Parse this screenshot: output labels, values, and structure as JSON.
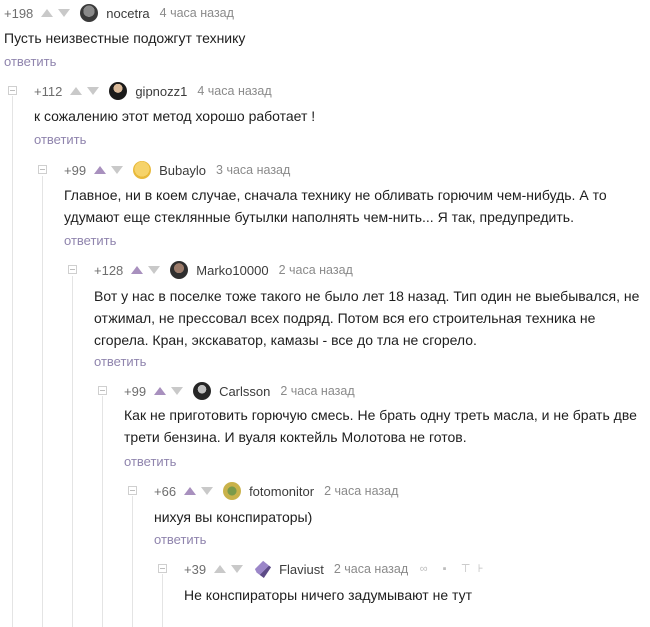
{
  "comments": [
    {
      "rating": "+198",
      "author": "nocetra",
      "time": "4 часа назад",
      "text": [
        "Пусть неизвестные подожгут технику"
      ],
      "reply": "ответить"
    },
    {
      "rating": "+112",
      "author": "gipnozz1",
      "time": "4 часа назад",
      "text": [
        "к сожалению этот метод хорошо работает !"
      ],
      "reply": "ответить"
    },
    {
      "rating": "+99",
      "author": "Bubaylo",
      "time": "3 часа назад",
      "text": [
        "Главное, ни в коем случае, сначала технику не обливать горючим чем-нибудь. А то",
        "удумают еще стеклянные бутылки наполнять чем-нить... Я так, предупредить."
      ],
      "reply": "ответить"
    },
    {
      "rating": "+128",
      "author": "Marko10000",
      "time": "2 часа назад",
      "text": [
        "Вот у нас в поселке тоже такого не было лет 18 назад. Тип один не выебывался, не",
        "отжимал, не прессовал всех подряд. Потом вся его строительная техника не",
        "сгорела. Кран, экскаватор, камазы - все до тла не сгорело."
      ],
      "reply": "ответить"
    },
    {
      "rating": "+99",
      "author": "Carlsson",
      "time": "2 часа назад",
      "text": [
        "Как не приготовить горючую смесь. Не брать одну треть масла, и не брать две",
        "трети бензина. И вуаля коктейль Молотова не готов."
      ],
      "reply": "ответить"
    },
    {
      "rating": "+66",
      "author": "fotomonitor",
      "time": "2 часа назад",
      "text": [
        "нихуя вы конспираторы)"
      ],
      "reply": "ответить"
    },
    {
      "rating": "+39",
      "author": "Flaviust",
      "time": "2 часа назад",
      "text": [
        "Не конспираторы ничего задумывают не тут"
      ],
      "reply": ""
    }
  ],
  "icons": {
    "vote_up": "arrow-up-icon",
    "vote_down": "arrow-down-icon",
    "collapse": "collapse-minus-icon",
    "link": "link-icon",
    "save": "save-icon",
    "share": "share-icon"
  }
}
